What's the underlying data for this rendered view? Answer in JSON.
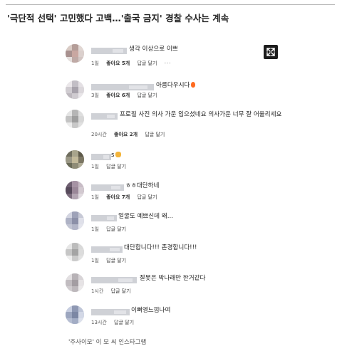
{
  "article": {
    "headline": "'극단적 선택' 고민했다 고백…'출국 금지' 경찰 수사는 계속",
    "caption": "'주사이모' 이 모 씨 인스타그램"
  },
  "comments": [
    {
      "text": "생각 이상으로 이쁘",
      "time": "1일",
      "likes": "좋아요 5개",
      "reply": "답글 달기",
      "more": "···",
      "emoji": ""
    },
    {
      "text": "아름다우시다",
      "time": "3일",
      "likes": "좋아요 6개",
      "reply": "답글 달기",
      "more": "",
      "emoji": "fire"
    },
    {
      "text": "프로필 사진 의사 가운 입으셨네요 의사가운 너무 잘 어울리세요",
      "time": "20시간",
      "likes": "좋아요 2개",
      "reply": "답글 달기",
      "more": "",
      "emoji": ""
    },
    {
      "text": "s",
      "time": "1일",
      "likes": "",
      "reply": "답글 달기",
      "more": "",
      "emoji": "clap"
    },
    {
      "text": "ㅎㅎ대단하네",
      "time": "1일",
      "likes": "좋아요 7개",
      "reply": "답글 달기",
      "more": "",
      "emoji": ""
    },
    {
      "text": "얼굴도 예쁘신데 왜...",
      "time": "1일",
      "likes": "",
      "reply": "답글 달기",
      "more": "",
      "emoji": ""
    },
    {
      "text": "대단합니다!!! 존경합니다!!!",
      "time": "1일",
      "likes": "",
      "reply": "답글 달기",
      "more": "",
      "emoji": ""
    },
    {
      "text": "잘못은 박나래만 한거같다",
      "time": "1시간",
      "likes": "",
      "reply": "답글 달기",
      "more": "",
      "emoji": ""
    },
    {
      "text": "이뻐엥느낌나여",
      "time": "13시간",
      "likes": "",
      "reply": "답글 달기",
      "more": "",
      "emoji": ""
    }
  ],
  "icons": {
    "expand": "expand-icon",
    "fire": "fire-emoji-icon",
    "clap": "clapping-hands-emoji-icon"
  },
  "colors": {
    "text": "#262626",
    "meta": "#555555",
    "expand_button": "#1c1c1c",
    "fire": "#ff6a1f",
    "clap": "#f3b43a"
  }
}
